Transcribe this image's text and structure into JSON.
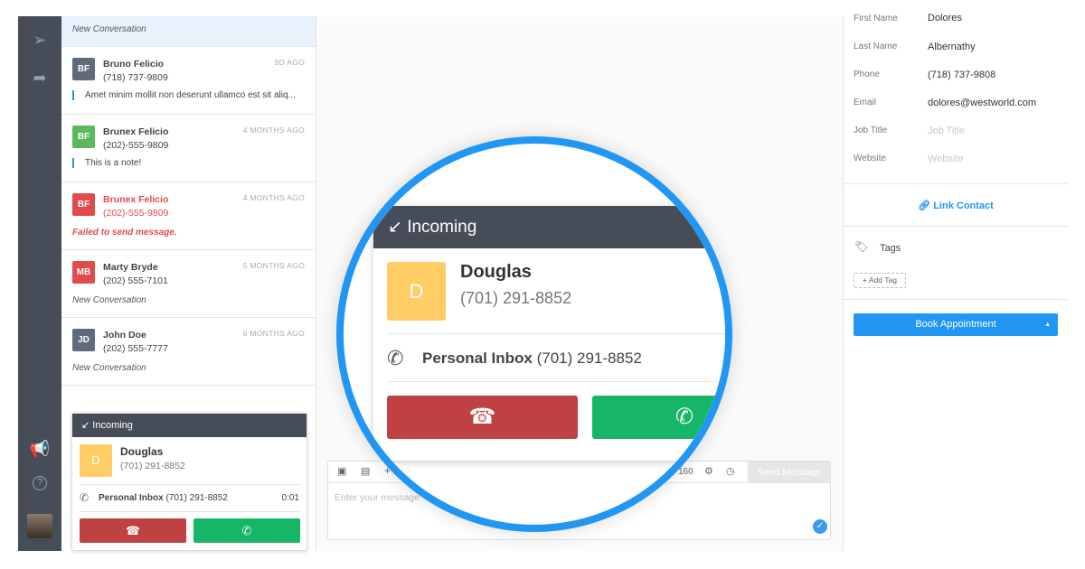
{
  "conversations": [
    {
      "preview": "New Conversation"
    },
    {
      "initials": "BF",
      "name": "Bruno Felicio",
      "phone": "(718) 737-9809",
      "time": "9D AGO",
      "preview": "Amet minim mollit non deserunt ullamco est sit aliq...",
      "color": "#5f6b7a"
    },
    {
      "initials": "BF",
      "name": "Brunex Felicio",
      "phone": "(202)-555-9809",
      "time": "4 MONTHS AGO",
      "preview": "This is a note!",
      "color": "#5cb85c"
    },
    {
      "initials": "BF",
      "name": "Brunex Felicio",
      "phone": "(202)-555-9809",
      "time": "4 MONTHS AGO",
      "preview": "Failed to send message.",
      "color": "#e04b4b"
    },
    {
      "initials": "MB",
      "name": "Marty Bryde",
      "phone": "(202) 555-7101",
      "time": "5 MONTHS AGO",
      "preview": "New Conversation",
      "color": "#e04b4b"
    },
    {
      "initials": "JD",
      "name": "John Doe",
      "phone": "(202) 555-7777",
      "time": "6 MONTHS AGO",
      "preview": "New Conversation",
      "color": "#5f6b7a"
    }
  ],
  "call": {
    "header": "Incoming",
    "initial": "D",
    "name": "Douglas",
    "phone": "(701) 291-8852",
    "inbox": "Personal Inbox",
    "inbox_phone": "(701) 291-8852",
    "duration": "0:01",
    "avatar_color": "#ffcc66",
    "decline_color": "#bf4141",
    "accept_color": "#17b566"
  },
  "composer": {
    "counter": "160",
    "send": "Send Message",
    "placeholder": "Enter your message"
  },
  "contact": {
    "fields": [
      {
        "label": "First Name",
        "value": "Dolores"
      },
      {
        "label": "Last Name",
        "value": "Albernathy"
      },
      {
        "label": "Phone",
        "value": "(718) 737-9808"
      },
      {
        "label": "Email",
        "value": "dolores@westworld.com"
      },
      {
        "label": "Job Title",
        "placeholder": "Job Title"
      },
      {
        "label": "Website",
        "placeholder": "Website"
      }
    ],
    "link": "Link Contact",
    "tags": "Tags",
    "add_tag": "+ Add Tag",
    "book": "Book Appointment"
  }
}
